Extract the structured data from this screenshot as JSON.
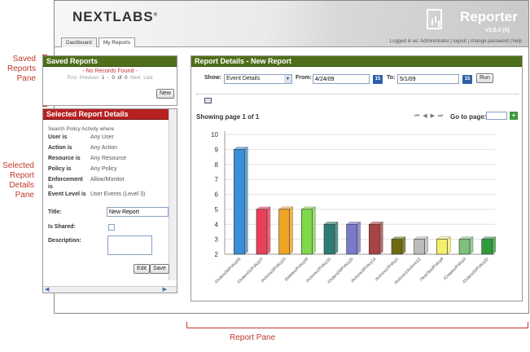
{
  "annotations": {
    "saved_reports_pane": "Saved\nReports\nPane",
    "selected_report_details_pane": "Selected\nReport\nDetails\nPane",
    "report_pane": "Report Pane"
  },
  "header": {
    "logo": "NEXTLABS",
    "logo_mark": "®",
    "app_name": "Reporter",
    "version": "v3.0.0 (0)",
    "user_line": "Logged in as: Administrator  |  logout  |  change password  |  help"
  },
  "tabs": [
    {
      "label": "Dashboard",
      "active": false
    },
    {
      "label": "My Reports",
      "active": true
    }
  ],
  "saved_reports": {
    "title": "Saved Reports",
    "empty_text": "- No Records Found -",
    "pager": {
      "first": "First",
      "previous": "Previous",
      "range": "1 - 0 of 0",
      "next": "Next",
      "last": "Last"
    },
    "new_label": "New"
  },
  "selected_details": {
    "title": "Selected Report Details",
    "intro": "Search Policy Activity where",
    "fields": [
      {
        "label": "User is",
        "value": "Any User"
      },
      {
        "label": "Action is",
        "value": "Any Action"
      },
      {
        "label": "Resource is",
        "value": "Any Resource"
      },
      {
        "label": "Policy is",
        "value": "Any Policy"
      },
      {
        "label": "Enforcement is",
        "value": "Allow/Monitor"
      },
      {
        "label": "Event Level is",
        "value": "User Events (Level 3)"
      }
    ],
    "title_label": "Title:",
    "title_value": "New Report",
    "shared_label": "Is Shared:",
    "description_label": "Description:",
    "edit_label": "Edit",
    "save_label": "Save"
  },
  "report_details": {
    "title": "Report Details - New Report",
    "show_label": "Show:",
    "show_value": "Event Details",
    "from_label": "From:",
    "from_value": "4/24/09",
    "to_label": "To:",
    "to_value": "5/1/09",
    "calendar_icon_text": "15",
    "run_label": "Run",
    "paging_text": "Showing page  1  of  1",
    "goto_label": "Go to page:",
    "goto_button": "+"
  },
  "chart_data": {
    "type": "bar",
    "categories": [
      "/Orders04/Policy05",
      "/Orders01/Policy07",
      "/Actions3/Policy15",
      "/Deletes/Policy08",
      "/Actions1/Policy10",
      "/Orders03/Policy20",
      "/Actions3/Policy14",
      "/Actions1/Policy1",
      "/Actions1/Actions12",
      "/Test/Test/Policy8",
      "/Creates/Policy3",
      "/Orders02/Policy22"
    ],
    "values": [
      9,
      5,
      5,
      5,
      4,
      4,
      4,
      3,
      3,
      3,
      3,
      3
    ],
    "colors": [
      "#3b8fd6",
      "#e8415a",
      "#f0a425",
      "#7fd84a",
      "#2e7b74",
      "#7a7ac8",
      "#a84444",
      "#6f6a10",
      "#bcbcbc",
      "#f2f06a",
      "#7cc07a",
      "#2f9a3a"
    ],
    "yticks": [
      2,
      3,
      4,
      5,
      6,
      7,
      8,
      9,
      10
    ],
    "ylim": [
      2,
      10
    ],
    "grid": true
  }
}
